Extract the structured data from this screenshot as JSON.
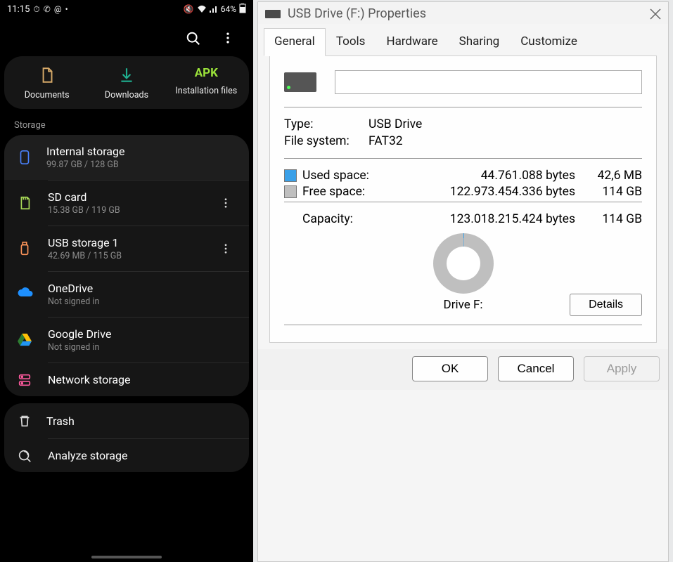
{
  "phone": {
    "status": {
      "time": "11:15",
      "battery_pct": "64%"
    },
    "quick": {
      "documents": "Documents",
      "downloads": "Downloads",
      "installation": "Installation files",
      "apk_label": "APK"
    },
    "section_storage": "Storage",
    "storage": [
      {
        "title": "Internal storage",
        "sub": "99.87 GB / 128 GB"
      },
      {
        "title": "SD card",
        "sub": "15.38 GB / 119 GB"
      },
      {
        "title": "USB storage 1",
        "sub": "42.69 MB / 115 GB"
      },
      {
        "title": "OneDrive",
        "sub": "Not signed in"
      },
      {
        "title": "Google Drive",
        "sub": "Not signed in"
      },
      {
        "title": "Network storage",
        "sub": ""
      }
    ],
    "bottom": {
      "trash": "Trash",
      "analyze": "Analyze storage"
    }
  },
  "win": {
    "title": "USB Drive (F:) Properties",
    "tabs": [
      "General",
      "Tools",
      "Hardware",
      "Sharing",
      "Customize"
    ],
    "drive_name": "",
    "type_label": "Type:",
    "type_value": "USB Drive",
    "fs_label": "File system:",
    "fs_value": "FAT32",
    "used_label": "Used space:",
    "used_bytes": "44.761.088 bytes",
    "used_size": "42,6 MB",
    "free_label": "Free space:",
    "free_bytes": "122.973.454.336 bytes",
    "free_size": "114 GB",
    "cap_label": "Capacity:",
    "cap_bytes": "123.018.215.424 bytes",
    "cap_size": "114 GB",
    "drive_letter": "Drive F:",
    "details_btn": "Details",
    "buttons": {
      "ok": "OK",
      "cancel": "Cancel",
      "apply": "Apply"
    }
  }
}
